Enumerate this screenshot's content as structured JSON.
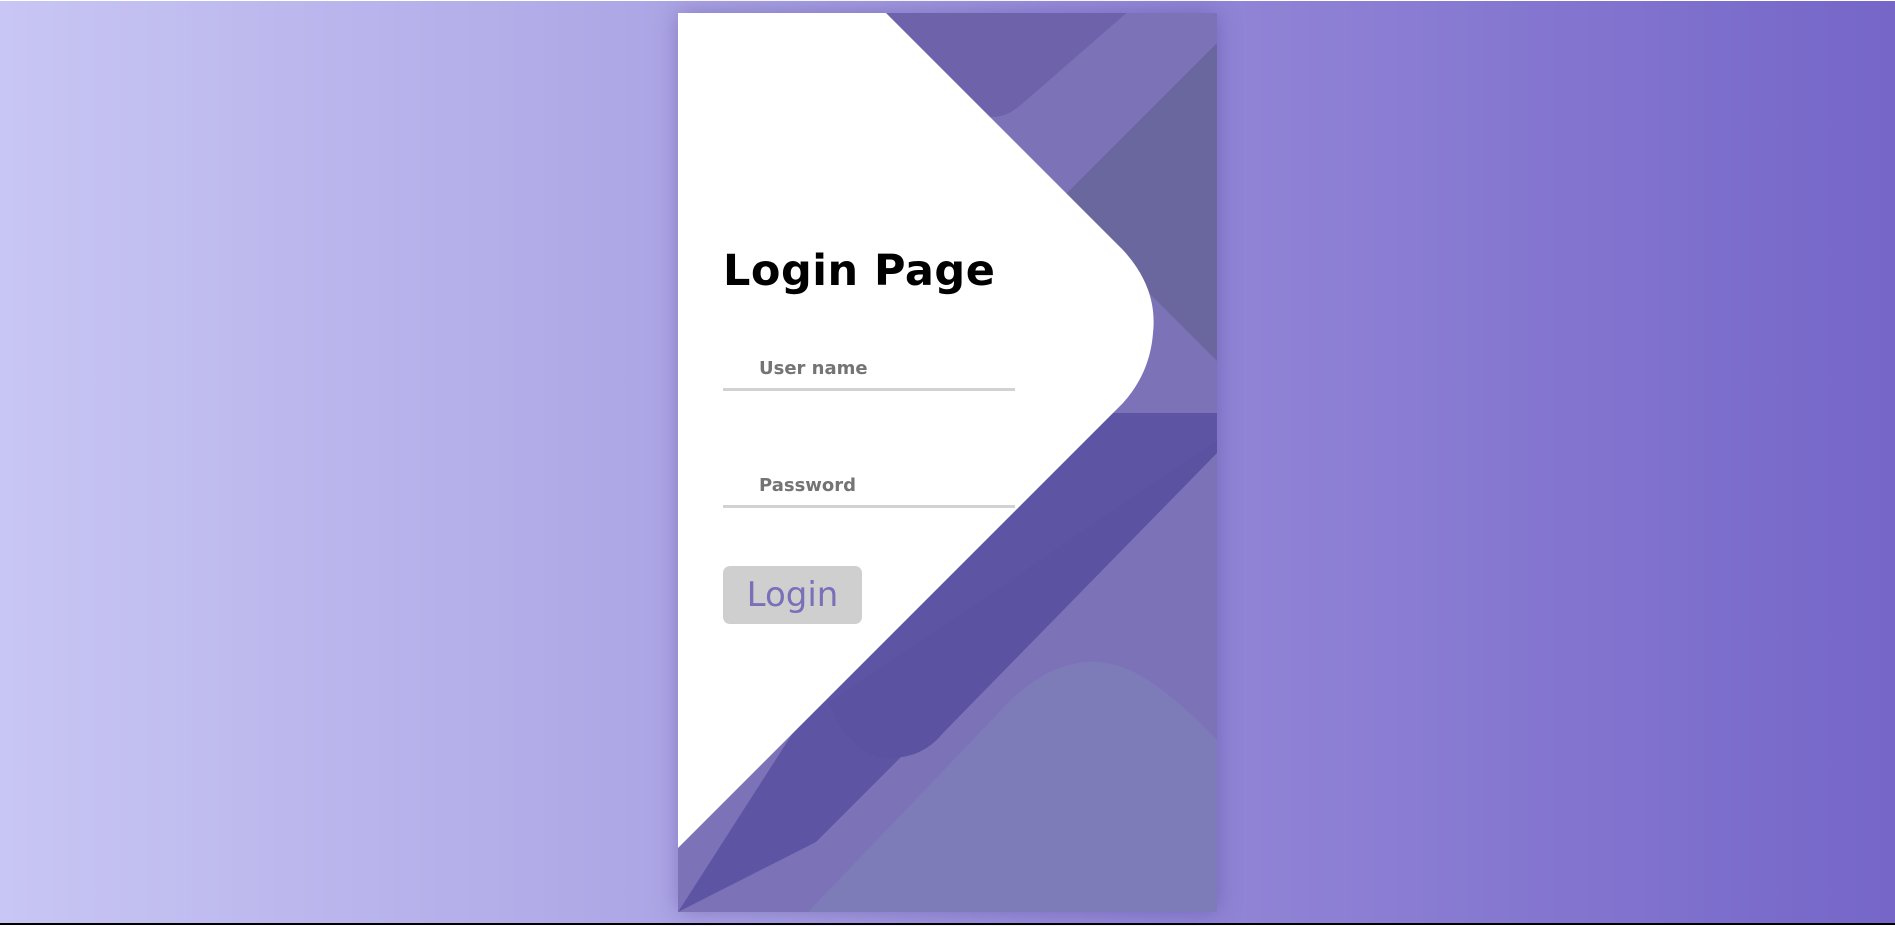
{
  "login": {
    "title": "Login Page",
    "username_placeholder": "User name",
    "username_value": "",
    "password_placeholder": "Password",
    "password_value": "",
    "button_label": "Login"
  },
  "colors": {
    "background_left": "#c8c6f4",
    "background_right": "#7566c8",
    "card_panel": "#7b72b8",
    "card_white": "#ffffff",
    "accent_purple": "#5f55a6",
    "button_background": "#cfcfcf",
    "button_text": "#7a70b8"
  }
}
